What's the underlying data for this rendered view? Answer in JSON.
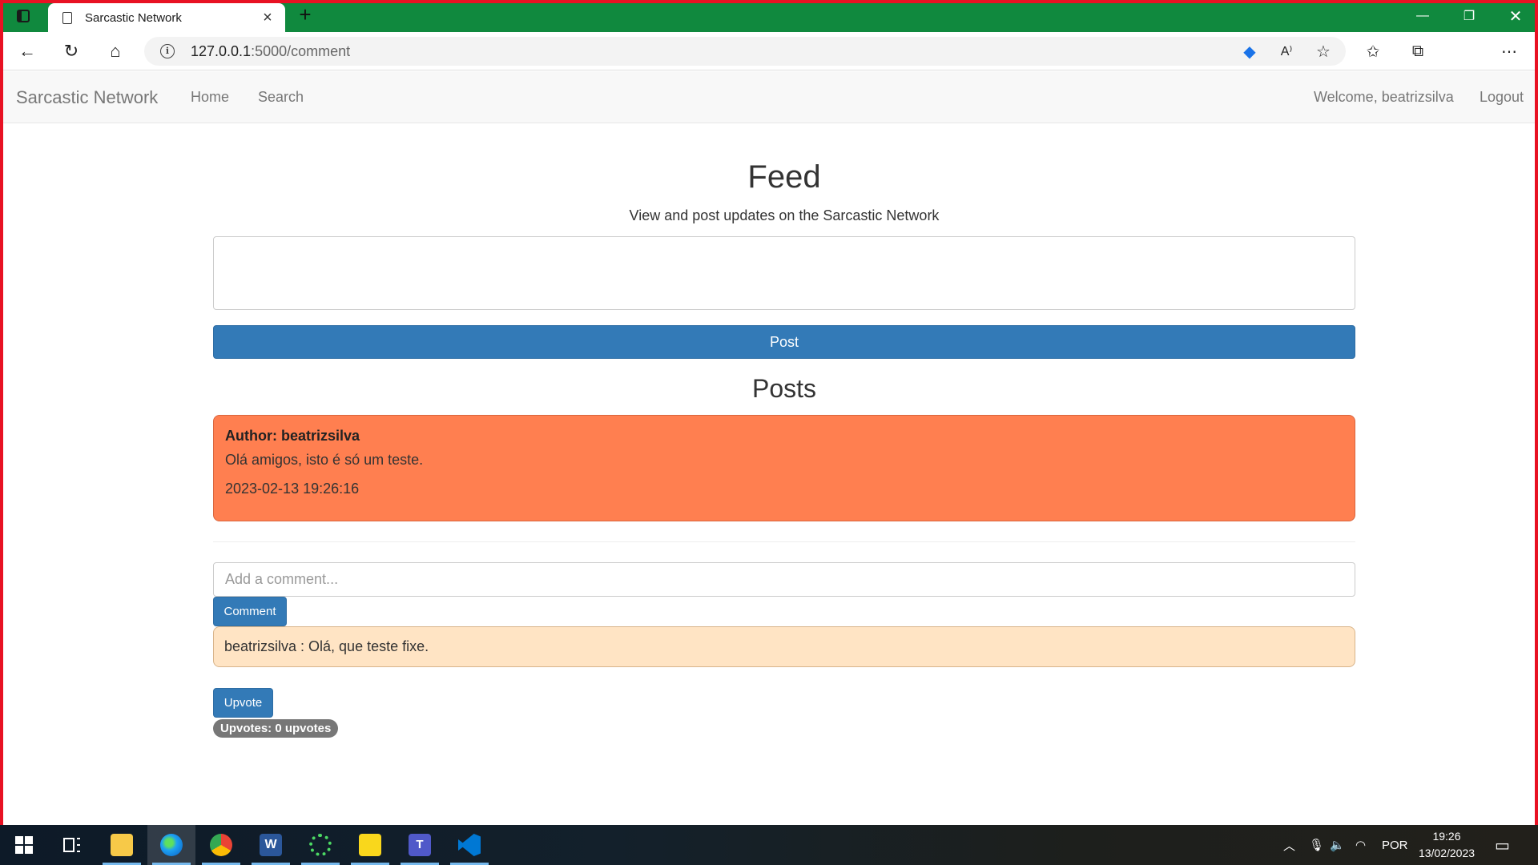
{
  "browser": {
    "tab_title": "Sarcastic Network",
    "url_host": "127.0.0.1",
    "url_path": ":5000/comment"
  },
  "navbar": {
    "brand": "Sarcastic Network",
    "links": [
      "Home",
      "Search"
    ],
    "welcome": "Welcome, beatrizsilva",
    "logout": "Logout"
  },
  "feed": {
    "title": "Feed",
    "subtitle": "View and post updates on the Sarcastic Network",
    "post_textarea_value": "",
    "post_button": "Post"
  },
  "posts": {
    "title": "Posts",
    "items": [
      {
        "author_line": "Author: beatrizsilva",
        "text": "Olá amigos, isto é só um teste.",
        "date": "2023-02-13 19:26:16",
        "comment_placeholder": "Add a comment...",
        "comment_button": "Comment",
        "comments": [
          "beatrizsilva : Olá, que teste fixe."
        ],
        "upvote_button": "Upvote",
        "upvotes_label": "Upvotes: 0 upvotes"
      }
    ]
  },
  "taskbar": {
    "language": "POR",
    "time": "19:26",
    "date": "13/02/2023"
  },
  "colors": {
    "titlebar": "#10893e",
    "frame": "#e81123",
    "primary": "#337ab7",
    "post_card": "#ff7f50",
    "comment_card": "#ffe4c4"
  }
}
